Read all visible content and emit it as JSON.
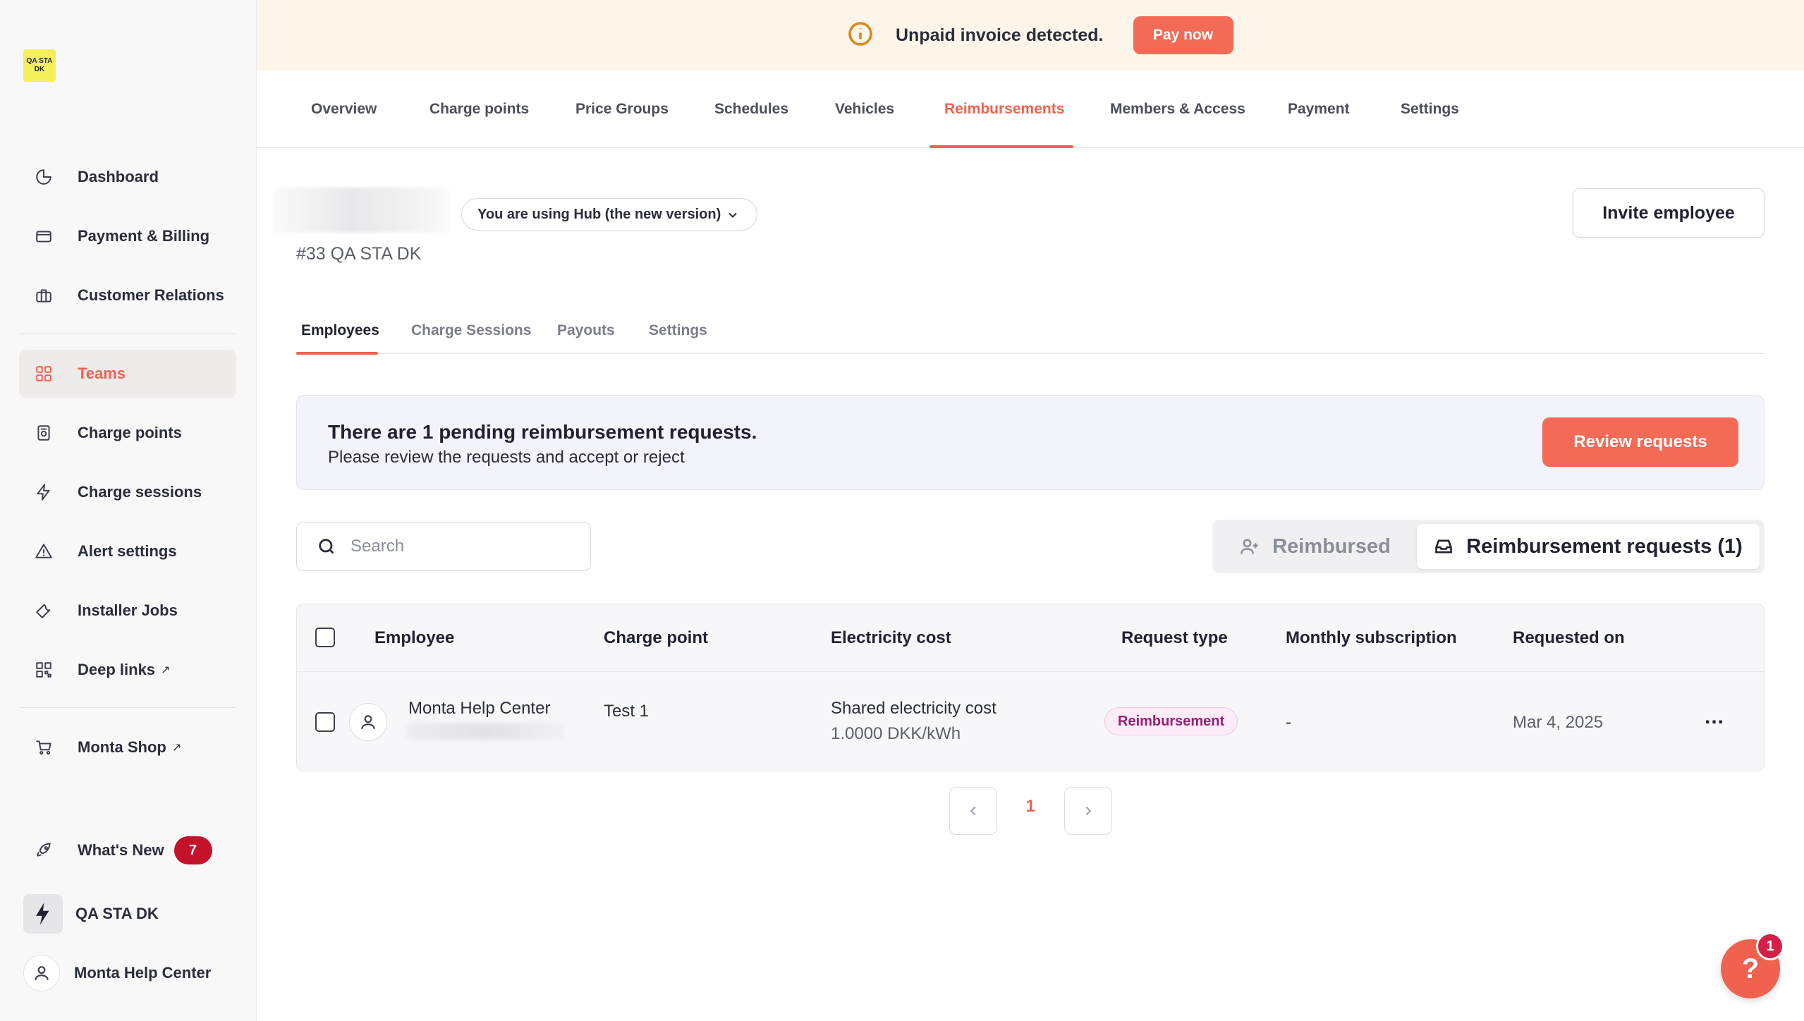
{
  "sidebar": {
    "logo_text": "QA STA DK",
    "items": [
      {
        "label": "Dashboard",
        "icon": "pie-chart-icon"
      },
      {
        "label": "Payment & Billing",
        "icon": "credit-card-icon"
      },
      {
        "label": "Customer Relations",
        "icon": "briefcase-icon"
      },
      {
        "label": "Teams",
        "icon": "grid-icon",
        "active": true
      },
      {
        "label": "Charge points",
        "icon": "charger-icon"
      },
      {
        "label": "Charge sessions",
        "icon": "lightning-icon"
      },
      {
        "label": "Alert settings",
        "icon": "alert-icon"
      },
      {
        "label": "Installer Jobs",
        "icon": "wrench-icon"
      },
      {
        "label": "Deep links",
        "icon": "qr-icon",
        "external": "↗"
      },
      {
        "label": "Monta Shop",
        "icon": "cart-icon",
        "external": "↗"
      }
    ],
    "whats_new": {
      "label": "What's New",
      "count": "7"
    },
    "account": {
      "label": "QA STA DK"
    },
    "user": {
      "label": "Monta Help Center"
    }
  },
  "banner": {
    "text": "Unpaid invoice detected.",
    "button": "Pay now"
  },
  "top_tabs": [
    "Overview",
    "Charge points",
    "Price Groups",
    "Schedules",
    "Vehicles",
    "Reimbursements",
    "Members & Access",
    "Payment",
    "Settings"
  ],
  "top_tabs_active": "Reimbursements",
  "header": {
    "version_select": "You are using Hub (the new version)",
    "team_id": "#33 QA STA DK",
    "invite_button": "Invite employee"
  },
  "sub_tabs": [
    "Employees",
    "Charge Sessions",
    "Payouts",
    "Settings"
  ],
  "sub_tabs_active": "Employees",
  "notice": {
    "title": "There are 1 pending reimbursement requests.",
    "subtitle": "Please review the requests and accept or reject",
    "button": "Review requests"
  },
  "search": {
    "placeholder": "Search",
    "value": ""
  },
  "segmented": {
    "reimbursed": "Reimbursed",
    "requests": "Reimbursement requests (1)",
    "active": "requests"
  },
  "table": {
    "columns": [
      "Employee",
      "Charge point",
      "Electricity cost",
      "Request type",
      "Monthly subscription",
      "Requested on"
    ],
    "rows": [
      {
        "employee": "Monta Help Center",
        "charge_point": "Test 1",
        "electricity_cost": "Shared electricity cost",
        "electricity_rate": "1.0000 DKK/kWh",
        "request_type": "Reimbursement",
        "monthly_subscription": "-",
        "requested_on": "Mar 4, 2025",
        "actions": "..."
      }
    ]
  },
  "pagination": {
    "current": "1"
  },
  "help": {
    "label": "?",
    "count": "1"
  },
  "colors": {
    "accent": "#f0624f",
    "banner_bg": "#fdf5e9",
    "badge": "#c4122a",
    "pill_text": "#9a1d7a"
  }
}
